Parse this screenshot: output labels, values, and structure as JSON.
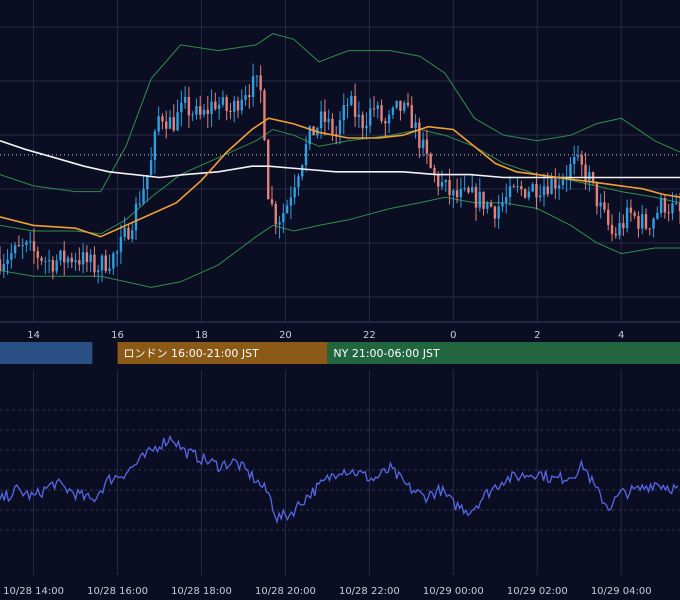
{
  "colors": {
    "background": "#0b0d22",
    "grid": "#262a45",
    "candle_up": "#2f9fe0",
    "candle_down": "#e2827a",
    "bollinger": "#2f8f4a",
    "ma_short": "#f0a030",
    "ma_long": "#f2f2f2",
    "oscillator": "#5668e8",
    "session_tokyo": "#2a4f82",
    "session_london": "#8a5a16",
    "session_ny": "#226640"
  },
  "sessions": [
    {
      "label": "",
      "start_hour": 13.2,
      "end_hour": 15.4,
      "color": "#2a4f82"
    },
    {
      "label": "ロンドン 16:00-21:00 JST",
      "start_hour": 16.0,
      "end_hour": 21.0,
      "color": "#8a5a16"
    },
    {
      "label": "NY 21:00-06:00 JST",
      "start_hour": 21.0,
      "end_hour": 30.0,
      "color": "#226640"
    }
  ],
  "chart_data": [
    {
      "type": "candlestick",
      "x_unit": "hour (JST, 10/28 base, values >24 are 10/29)",
      "x_range": [
        13.2,
        29.4
      ],
      "y_range": [
        0,
        100
      ],
      "x_tick_labels": [
        {
          "x": 14,
          "label": "14"
        },
        {
          "x": 16,
          "label": "16"
        },
        {
          "x": 18,
          "label": "18"
        },
        {
          "x": 20,
          "label": "20"
        },
        {
          "x": 22,
          "label": "22"
        },
        {
          "x": 24,
          "label": "0"
        },
        {
          "x": 26,
          "label": "2"
        },
        {
          "x": 28,
          "label": "4"
        }
      ],
      "reference_level": 55,
      "price_key_points": [
        [
          13.2,
          18
        ],
        [
          13.8,
          22
        ],
        [
          14.4,
          17
        ],
        [
          15.0,
          19
        ],
        [
          15.5,
          15
        ],
        [
          16.0,
          20
        ],
        [
          16.4,
          34
        ],
        [
          16.8,
          52
        ],
        [
          17.0,
          70
        ],
        [
          17.3,
          66
        ],
        [
          17.6,
          72
        ],
        [
          18.0,
          68
        ],
        [
          18.3,
          74
        ],
        [
          18.7,
          70
        ],
        [
          19.0,
          78
        ],
        [
          19.3,
          80
        ],
        [
          19.45,
          76
        ],
        [
          19.6,
          40
        ],
        [
          19.8,
          32
        ],
        [
          20.0,
          36
        ],
        [
          20.3,
          50
        ],
        [
          20.6,
          62
        ],
        [
          20.9,
          68
        ],
        [
          21.2,
          62
        ],
        [
          21.5,
          74
        ],
        [
          21.8,
          66
        ],
        [
          22.1,
          72
        ],
        [
          22.4,
          65
        ],
        [
          22.7,
          72
        ],
        [
          23.0,
          68
        ],
        [
          23.2,
          60
        ],
        [
          23.5,
          48
        ],
        [
          24.0,
          40
        ],
        [
          24.5,
          40
        ],
        [
          25.0,
          36
        ],
        [
          25.5,
          42
        ],
        [
          26.0,
          44
        ],
        [
          26.5,
          46
        ],
        [
          26.9,
          52
        ],
        [
          27.2,
          48
        ],
        [
          27.5,
          36
        ],
        [
          27.8,
          26
        ],
        [
          28.2,
          34
        ],
        [
          28.6,
          30
        ],
        [
          29.0,
          38
        ],
        [
          29.4,
          34
        ]
      ],
      "bollinger": {
        "middle": [
          [
            13.2,
            30
          ],
          [
            14,
            28
          ],
          [
            15,
            28
          ],
          [
            15.6,
            27
          ],
          [
            16.2,
            32
          ],
          [
            16.8,
            40
          ],
          [
            17.5,
            48
          ],
          [
            18.4,
            54
          ],
          [
            19.3,
            60
          ],
          [
            19.7,
            64
          ],
          [
            20.2,
            62
          ],
          [
            20.8,
            58
          ],
          [
            21.5,
            60
          ],
          [
            22.5,
            62
          ],
          [
            23.2,
            64
          ],
          [
            23.8,
            62
          ],
          [
            24.5,
            58
          ],
          [
            25.2,
            52
          ],
          [
            26.0,
            48
          ],
          [
            26.8,
            46
          ],
          [
            27.4,
            44
          ],
          [
            28.0,
            42
          ],
          [
            28.8,
            40
          ],
          [
            29.4,
            38
          ]
        ],
        "upper": [
          [
            13.2,
            48
          ],
          [
            14,
            44
          ],
          [
            15,
            42
          ],
          [
            15.6,
            42
          ],
          [
            16.2,
            58
          ],
          [
            16.8,
            82
          ],
          [
            17.5,
            94
          ],
          [
            18.4,
            92
          ],
          [
            19.3,
            94
          ],
          [
            19.7,
            98
          ],
          [
            20.2,
            96
          ],
          [
            20.8,
            88
          ],
          [
            21.5,
            92
          ],
          [
            22.5,
            92
          ],
          [
            23.2,
            90
          ],
          [
            23.8,
            84
          ],
          [
            24.5,
            68
          ],
          [
            25.2,
            62
          ],
          [
            26.0,
            60
          ],
          [
            26.8,
            62
          ],
          [
            27.4,
            66
          ],
          [
            28.0,
            68
          ],
          [
            28.8,
            60
          ],
          [
            29.4,
            56
          ]
        ],
        "lower": [
          [
            13.2,
            14
          ],
          [
            14,
            12
          ],
          [
            15,
            12
          ],
          [
            15.6,
            12
          ],
          [
            16.2,
            10
          ],
          [
            16.8,
            8
          ],
          [
            17.5,
            10
          ],
          [
            18.4,
            16
          ],
          [
            19.3,
            26
          ],
          [
            19.7,
            30
          ],
          [
            20.2,
            28
          ],
          [
            20.8,
            30
          ],
          [
            21.5,
            32
          ],
          [
            22.5,
            36
          ],
          [
            23.2,
            38
          ],
          [
            23.8,
            40
          ],
          [
            24.5,
            38
          ],
          [
            25.2,
            38
          ],
          [
            26.0,
            36
          ],
          [
            26.8,
            30
          ],
          [
            27.4,
            24
          ],
          [
            28.0,
            20
          ],
          [
            28.8,
            22
          ],
          [
            29.4,
            22
          ]
        ]
      },
      "ma_short": [
        [
          13.2,
          33
        ],
        [
          14,
          30
        ],
        [
          15,
          29
        ],
        [
          15.6,
          26
        ],
        [
          16.2,
          30
        ],
        [
          16.8,
          34
        ],
        [
          17.4,
          38
        ],
        [
          18.0,
          46
        ],
        [
          18.6,
          56
        ],
        [
          19.2,
          64
        ],
        [
          19.6,
          68
        ],
        [
          20.2,
          66
        ],
        [
          20.8,
          63
        ],
        [
          21.5,
          61
        ],
        [
          22.2,
          61
        ],
        [
          22.8,
          62
        ],
        [
          23.4,
          65
        ],
        [
          24.0,
          64
        ],
        [
          24.5,
          58
        ],
        [
          25.0,
          52
        ],
        [
          25.5,
          49
        ],
        [
          26.0,
          48
        ],
        [
          26.5,
          47
        ],
        [
          27.0,
          46
        ],
        [
          27.5,
          45
        ],
        [
          28.0,
          44
        ],
        [
          28.5,
          43
        ],
        [
          29.0,
          41
        ],
        [
          29.4,
          40
        ]
      ],
      "ma_long": [
        [
          13.2,
          60
        ],
        [
          13.8,
          57
        ],
        [
          14.5,
          54
        ],
        [
          15.2,
          51
        ],
        [
          15.8,
          49
        ],
        [
          16.4,
          48
        ],
        [
          17.0,
          47
        ],
        [
          17.6,
          48
        ],
        [
          18.4,
          49
        ],
        [
          19.2,
          51
        ],
        [
          19.6,
          51
        ],
        [
          20.4,
          50
        ],
        [
          21.2,
          49
        ],
        [
          22.0,
          49
        ],
        [
          22.8,
          49
        ],
        [
          23.6,
          48
        ],
        [
          24.4,
          48
        ],
        [
          25.2,
          47
        ],
        [
          26.0,
          47
        ],
        [
          26.8,
          47
        ],
        [
          27.6,
          47
        ],
        [
          28.4,
          47
        ],
        [
          29.4,
          47
        ]
      ]
    },
    {
      "type": "line",
      "x_unit": "hour (JST)",
      "x_range": [
        13.2,
        29.4
      ],
      "y_range": [
        0,
        100
      ],
      "x_tick_labels": [
        {
          "x": 14,
          "label": "10/28 14:00"
        },
        {
          "x": 16,
          "label": "10/28 16:00"
        },
        {
          "x": 18,
          "label": "10/28 18:00"
        },
        {
          "x": 20,
          "label": "10/28 20:00"
        },
        {
          "x": 22,
          "label": "10/28 22:00"
        },
        {
          "x": 24,
          "label": "10/29 00:00"
        },
        {
          "x": 26,
          "label": "10/29 02:00"
        },
        {
          "x": 28,
          "label": "10/29 04:00"
        }
      ],
      "key_points": [
        [
          13.2,
          38
        ],
        [
          13.6,
          44
        ],
        [
          14.0,
          40
        ],
        [
          14.5,
          48
        ],
        [
          15.0,
          42
        ],
        [
          15.4,
          38
        ],
        [
          15.8,
          50
        ],
        [
          16.2,
          54
        ],
        [
          16.6,
          62
        ],
        [
          17.0,
          70
        ],
        [
          17.3,
          74
        ],
        [
          17.6,
          66
        ],
        [
          18.0,
          62
        ],
        [
          18.4,
          58
        ],
        [
          18.8,
          60
        ],
        [
          19.2,
          52
        ],
        [
          19.6,
          42
        ],
        [
          19.8,
          28
        ],
        [
          20.1,
          30
        ],
        [
          20.5,
          40
        ],
        [
          20.9,
          48
        ],
        [
          21.3,
          56
        ],
        [
          21.7,
          54
        ],
        [
          22.1,
          50
        ],
        [
          22.5,
          56
        ],
        [
          22.9,
          46
        ],
        [
          23.3,
          40
        ],
        [
          23.7,
          44
        ],
        [
          24.0,
          36
        ],
        [
          24.4,
          32
        ],
        [
          24.8,
          42
        ],
        [
          25.2,
          50
        ],
        [
          25.6,
          52
        ],
        [
          26.0,
          54
        ],
        [
          26.4,
          50
        ],
        [
          26.8,
          52
        ],
        [
          27.1,
          58
        ],
        [
          27.4,
          44
        ],
        [
          27.7,
          34
        ],
        [
          28.0,
          42
        ],
        [
          28.4,
          44
        ],
        [
          28.8,
          48
        ],
        [
          29.4,
          44
        ]
      ]
    }
  ]
}
